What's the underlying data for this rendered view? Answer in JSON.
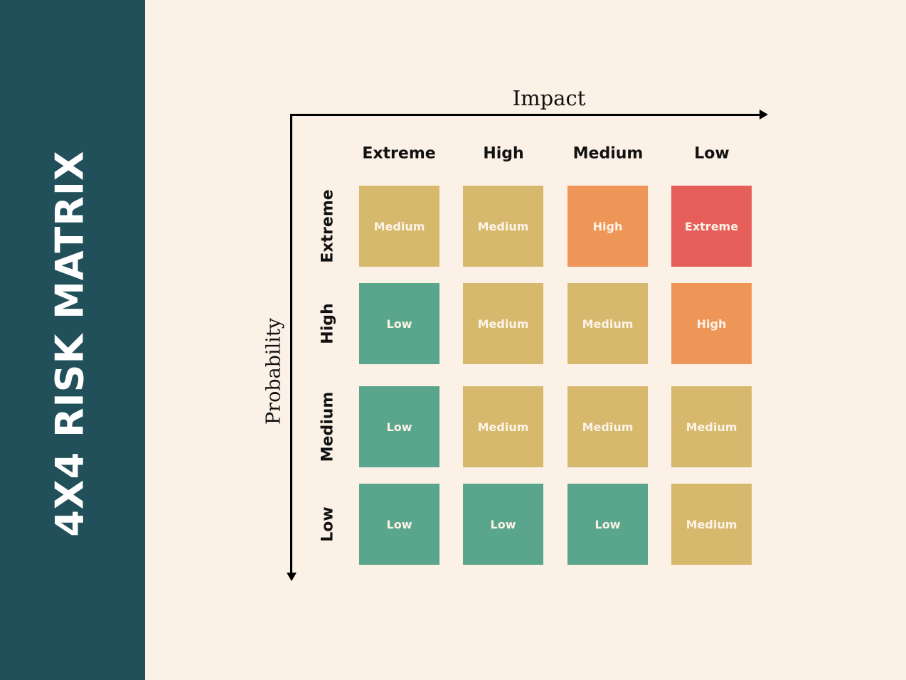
{
  "title": "4X4 RISK MATRIX",
  "x_axis_label": "Impact",
  "y_axis_label": "Probability",
  "colors": {
    "sidebar": "#22505a",
    "background": "#fbf1e6",
    "Low": "#59a68c",
    "Medium": "#d7b96e",
    "High": "#ee9657",
    "Extreme": "#e65e5a"
  },
  "columns": [
    "Extreme",
    "High",
    "Medium",
    "Low"
  ],
  "rows": [
    "Extreme",
    "High",
    "Medium",
    "Low"
  ],
  "cells": [
    [
      "Medium",
      "Medium",
      "High",
      "Extreme"
    ],
    [
      "Low",
      "Medium",
      "Medium",
      "High"
    ],
    [
      "Low",
      "Medium",
      "Medium",
      "Medium"
    ],
    [
      "Low",
      "Low",
      "Low",
      "Medium"
    ]
  ]
}
